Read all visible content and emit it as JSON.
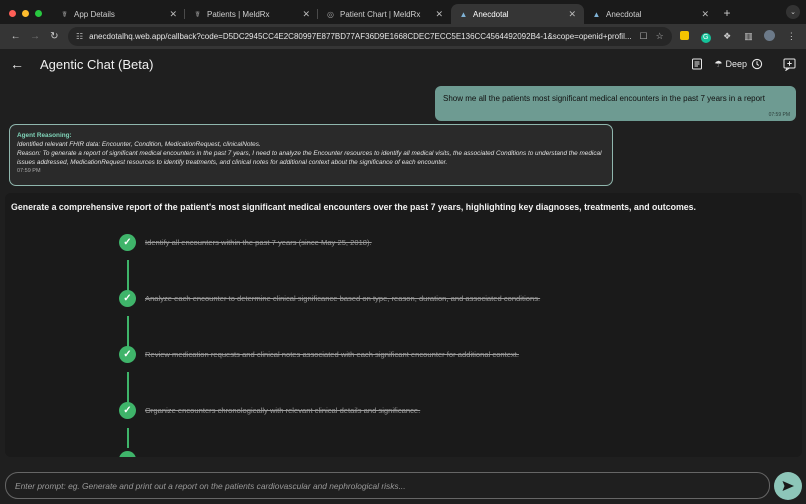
{
  "browser": {
    "tabs": [
      {
        "label": "App Details",
        "icon": "meldrx-icon",
        "active": false
      },
      {
        "label": "Patients | MeldRx",
        "icon": "meldrx-icon",
        "active": false
      },
      {
        "label": "Patient Chart | MeldRx",
        "icon": "meldrx-icon",
        "active": false
      },
      {
        "label": "Anecdotal",
        "icon": "anecdotal-icon",
        "active": true
      },
      {
        "label": "Anecdotal",
        "icon": "anecdotal-icon",
        "active": false
      }
    ],
    "url": "anecdotalhq.web.app/callback?code=D5DC2945CC4E2C80997E877BD77AF36D9E1668CDEC7ECC5E136CC4564492092B4-1&scope=openid+profil..."
  },
  "header": {
    "title": "Agentic Chat (Beta)",
    "deep_label": "Deep"
  },
  "chat": {
    "user_message": {
      "text": "Show me all the patients most significant medical encounters in the past 7 years in a report",
      "time": "07:59 PM"
    },
    "reasoning": {
      "title": "Agent Reasoning:",
      "identified": "Identified relevant FHIR data: Encounter, Condition, MedicationRequest, clinicalNotes.",
      "reason": "Reason: To generate a report of significant medical encounters in the past 7 years, I need to analyze the Encounter resources to identify all medical visits, the associated Conditions to understand the medical issues addressed, MedicationRequest resources to identify treatments, and clinical notes for additional context about the significance of each encounter.",
      "time": "07:59 PM"
    },
    "report": {
      "heading": "Generate a comprehensive report of the patient's most significant medical encounters over the past 7 years, highlighting key diagnoses, treatments, and outcomes.",
      "steps": [
        {
          "text": "Identify all encounters within the past 7 years (since May 25, 2018).",
          "done": true
        },
        {
          "text": "Analyze each encounter to determine clinical significance based on type, reason, duration, and associated conditions.",
          "done": true
        },
        {
          "text": "Review medication requests and clinical notes associated with each significant encounter for additional context.",
          "done": true
        },
        {
          "text": "Organize encounters chronologically with relevant clinical details and significance.",
          "done": true
        }
      ]
    }
  },
  "input": {
    "placeholder": "Enter prompt: eg. Generate and print out a report on the patients cardiovascular and nephrological risks..."
  },
  "colors": {
    "accent": "#6e9b92",
    "check": "#3fb46a",
    "send": "#8dc6b9",
    "reasoning_title": "#7fd3b8"
  }
}
